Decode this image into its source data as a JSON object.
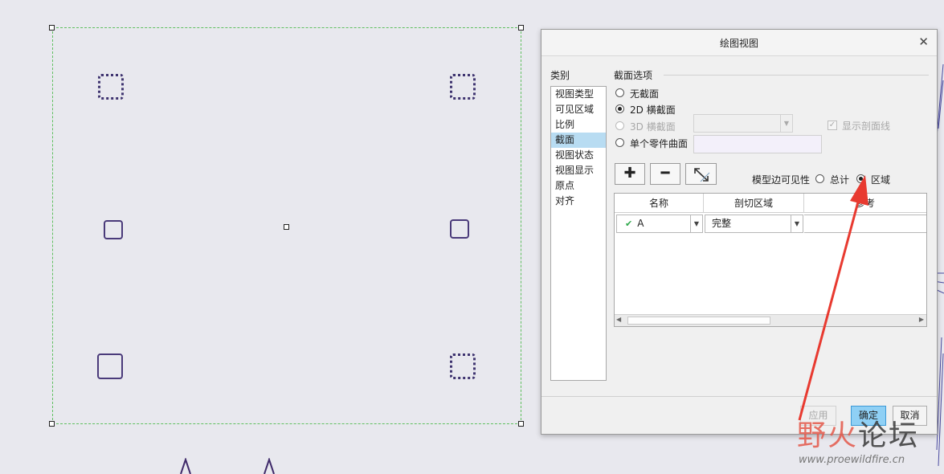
{
  "dialog": {
    "title": "绘图视图",
    "close_icon": "close-icon",
    "category_label": "类别",
    "categories": [
      "视图类型",
      "可见区域",
      "比例",
      "截面",
      "视图状态",
      "视图显示",
      "原点",
      "对齐"
    ],
    "selected_category": "截面",
    "section_options": {
      "group_label": "截面选项",
      "options": [
        {
          "label": "无截面",
          "checked": false,
          "disabled": false
        },
        {
          "label": "2D 横截面",
          "checked": true,
          "disabled": false
        },
        {
          "label": "3D 横截面",
          "checked": false,
          "disabled": true
        },
        {
          "label": "单个零件曲面",
          "checked": false,
          "disabled": false
        }
      ],
      "show_hatch_label": "显示剖面线",
      "show_hatch_checked": true,
      "show_hatch_disabled": true
    },
    "toolbar": {
      "add_icon": "plus-icon",
      "remove_icon": "minus-icon",
      "edit_icon": "resize-arrow-icon"
    },
    "visibility": {
      "label": "模型边可见性",
      "options": [
        {
          "label": "总计",
          "checked": false
        },
        {
          "label": "区域",
          "checked": true
        }
      ]
    },
    "table": {
      "columns": [
        "名称",
        "剖切区域",
        "参考"
      ],
      "rows": [
        {
          "name": "A",
          "status_icon": "green-check-icon",
          "region": "完整",
          "reference": ""
        }
      ]
    },
    "buttons": {
      "apply": "应用",
      "ok": "确定",
      "cancel": "取消"
    }
  },
  "watermark": {
    "text": "野火论坛",
    "url": "www.proewildfire.cn"
  },
  "colors": {
    "canvas_bg": "#e8e8ee",
    "selection_border": "#5fbf5f",
    "selected_category": "#b8dcf2",
    "ok_button": "#8fd0f5",
    "annotation_arrow": "#e83a30"
  }
}
